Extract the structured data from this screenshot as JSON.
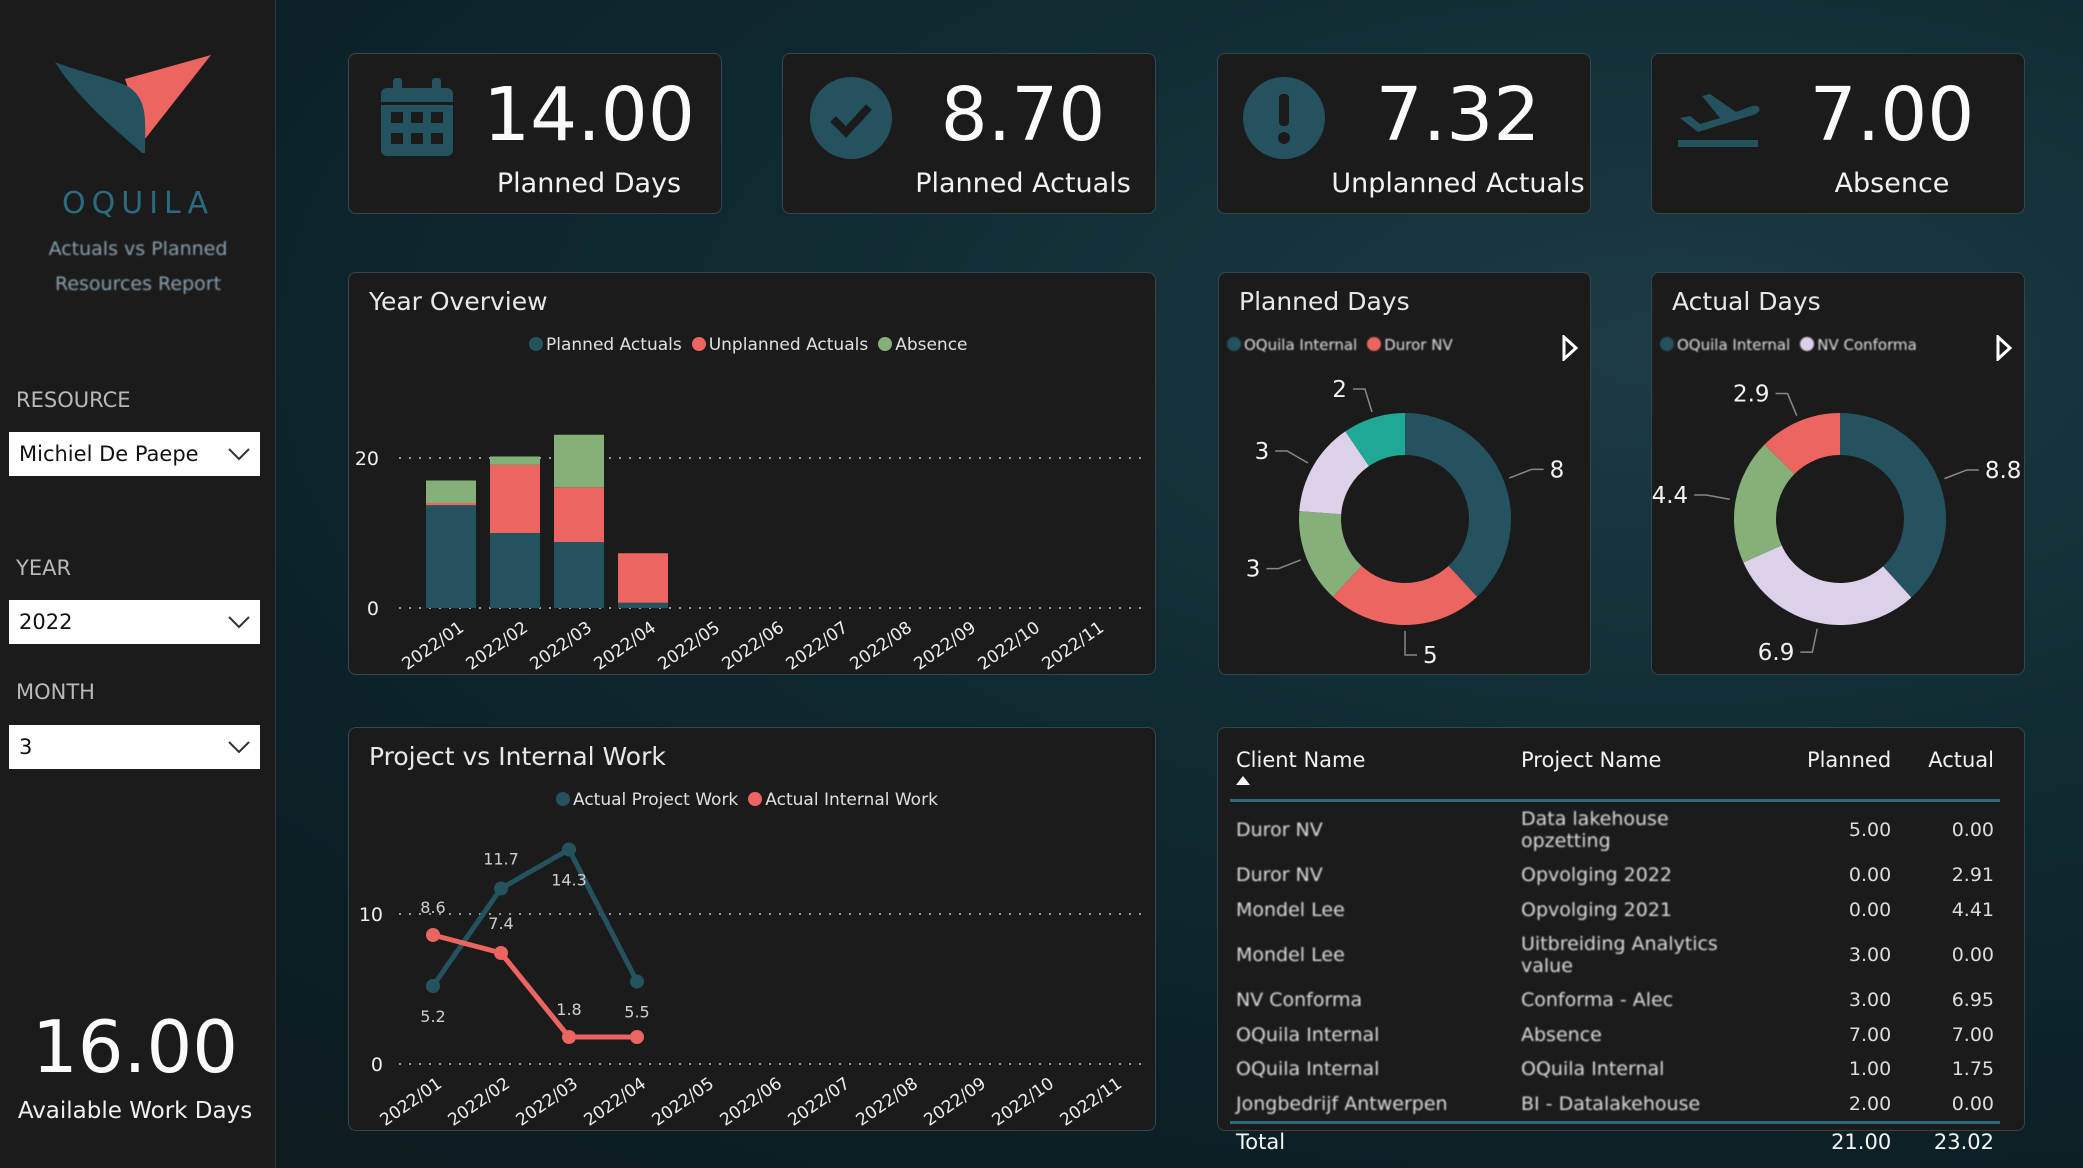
{
  "sidebar": {
    "brand": "OQUILA",
    "subtitle_line1": "Actuals vs Planned",
    "subtitle_line2": "Resources Report",
    "resource_label": "RESOURCE",
    "resource_value": "Michiel De Paepe",
    "year_label": "YEAR",
    "year_value": "2022",
    "month_label": "MONTH",
    "month_value": "3",
    "available_value": "16.00",
    "available_label": "Available Work Days"
  },
  "kpis": [
    {
      "value": "14.00",
      "label": "Planned Days",
      "icon": "calendar-icon"
    },
    {
      "value": "8.70",
      "label": "Planned Actuals",
      "icon": "check-circle-icon"
    },
    {
      "value": "7.32",
      "label": "Unplanned Actuals",
      "icon": "exclamation-circle-icon"
    },
    {
      "value": "7.00",
      "label": "Absence",
      "icon": "airplane-departure-icon"
    }
  ],
  "colors": {
    "dark_teal": "#24535f",
    "red": "#ec6561",
    "green": "#86b07a",
    "lavender": "#ddd0e9",
    "teal": "#1fa896",
    "icon": "#24535f"
  },
  "chart_data": [
    {
      "id": "year_overview",
      "type": "bar",
      "stacked": true,
      "title": "Year Overview",
      "categories": [
        "2022/01",
        "2022/02",
        "2022/03",
        "2022/04",
        "2022/05",
        "2022/06",
        "2022/07",
        "2022/08",
        "2022/09",
        "2022/10",
        "2022/11"
      ],
      "series": [
        {
          "name": "Planned Actuals",
          "color": "#24535f",
          "values": [
            13.7,
            10.0,
            8.8,
            0.7,
            0,
            0,
            0,
            0,
            0,
            0,
            0
          ]
        },
        {
          "name": "Unplanned Actuals",
          "color": "#ec6561",
          "values": [
            0.3,
            9.1,
            7.3,
            6.6,
            0,
            0,
            0,
            0,
            0,
            0,
            0
          ]
        },
        {
          "name": "Absence",
          "color": "#86b07a",
          "values": [
            3.0,
            1.1,
            7.0,
            0,
            0,
            0,
            0,
            0,
            0,
            0,
            0
          ]
        }
      ],
      "yticks": [
        0,
        20
      ],
      "ylim": [
        0,
        25
      ],
      "grid": true,
      "legend": "top-center"
    },
    {
      "id": "planned_days",
      "type": "pie",
      "donut": true,
      "title": "Planned Days",
      "legend_entries": [
        "OQuila Internal",
        "Duror NV"
      ],
      "legend": "top",
      "slices": [
        {
          "value": 8,
          "label": "8",
          "color": "#24535f"
        },
        {
          "value": 5,
          "label": "5",
          "color": "#ec6561"
        },
        {
          "value": 3,
          "label": "3",
          "color": "#86b07a"
        },
        {
          "value": 3,
          "label": "3",
          "color": "#ddd0e9"
        },
        {
          "value": 2,
          "label": "2",
          "color": "#1fa896"
        }
      ]
    },
    {
      "id": "actual_days",
      "type": "pie",
      "donut": true,
      "title": "Actual Days",
      "legend_entries": [
        "OQuila Internal",
        "NV Conforma"
      ],
      "legend": "top",
      "slices": [
        {
          "value": 8.8,
          "label": "8.8",
          "color": "#24535f"
        },
        {
          "value": 6.9,
          "label": "6.9",
          "color": "#ddd0e9"
        },
        {
          "value": 4.4,
          "label": "4.4",
          "color": "#86b07a"
        },
        {
          "value": 2.9,
          "label": "2.9",
          "color": "#ec6561"
        }
      ]
    },
    {
      "id": "project_vs_internal",
      "type": "line",
      "title": "Project vs Internal Work",
      "categories": [
        "2022/01",
        "2022/02",
        "2022/03",
        "2022/04",
        "2022/05",
        "2022/06",
        "2022/07",
        "2022/08",
        "2022/09",
        "2022/10",
        "2022/11"
      ],
      "series": [
        {
          "name": "Actual Project Work",
          "color": "#24535f",
          "values": [
            5.2,
            11.7,
            14.3,
            5.5
          ],
          "labels": [
            "5.2",
            "11.7",
            "14.3",
            "5.5"
          ]
        },
        {
          "name": "Actual Internal Work",
          "color": "#ec6561",
          "values": [
            8.6,
            7.4,
            1.8,
            1.8
          ],
          "labels": [
            "8.6",
            "7.4",
            "1.8",
            ""
          ]
        }
      ],
      "yticks": [
        0,
        10
      ],
      "ylim": [
        0,
        17
      ],
      "grid": true,
      "legend": "top-center"
    }
  ],
  "table": {
    "headers": [
      "Client Name",
      "Project Name",
      "Planned",
      "Actual"
    ],
    "sorted_column": "Client Name",
    "rows": [
      [
        "Duror NV",
        "Data lakehouse opzetting",
        "5.00",
        "0.00"
      ],
      [
        "Duror NV",
        "Opvolging 2022",
        "0.00",
        "2.91"
      ],
      [
        "Mondel Lee",
        "Opvolging 2021",
        "0.00",
        "4.41"
      ],
      [
        "Mondel Lee",
        "Uitbreiding Analytics value",
        "3.00",
        "0.00"
      ],
      [
        "NV Conforma",
        "Conforma - Alec",
        "3.00",
        "6.95"
      ],
      [
        "OQuila Internal",
        "Absence",
        "7.00",
        "7.00"
      ],
      [
        "OQuila Internal",
        "OQuila Internal",
        "1.00",
        "1.75"
      ],
      [
        "Jongbedrijf Antwerpen",
        "BI - Datalakehouse",
        "2.00",
        "0.00"
      ]
    ],
    "total_label": "Total",
    "total_planned": "21.00",
    "total_actual": "23.02"
  }
}
